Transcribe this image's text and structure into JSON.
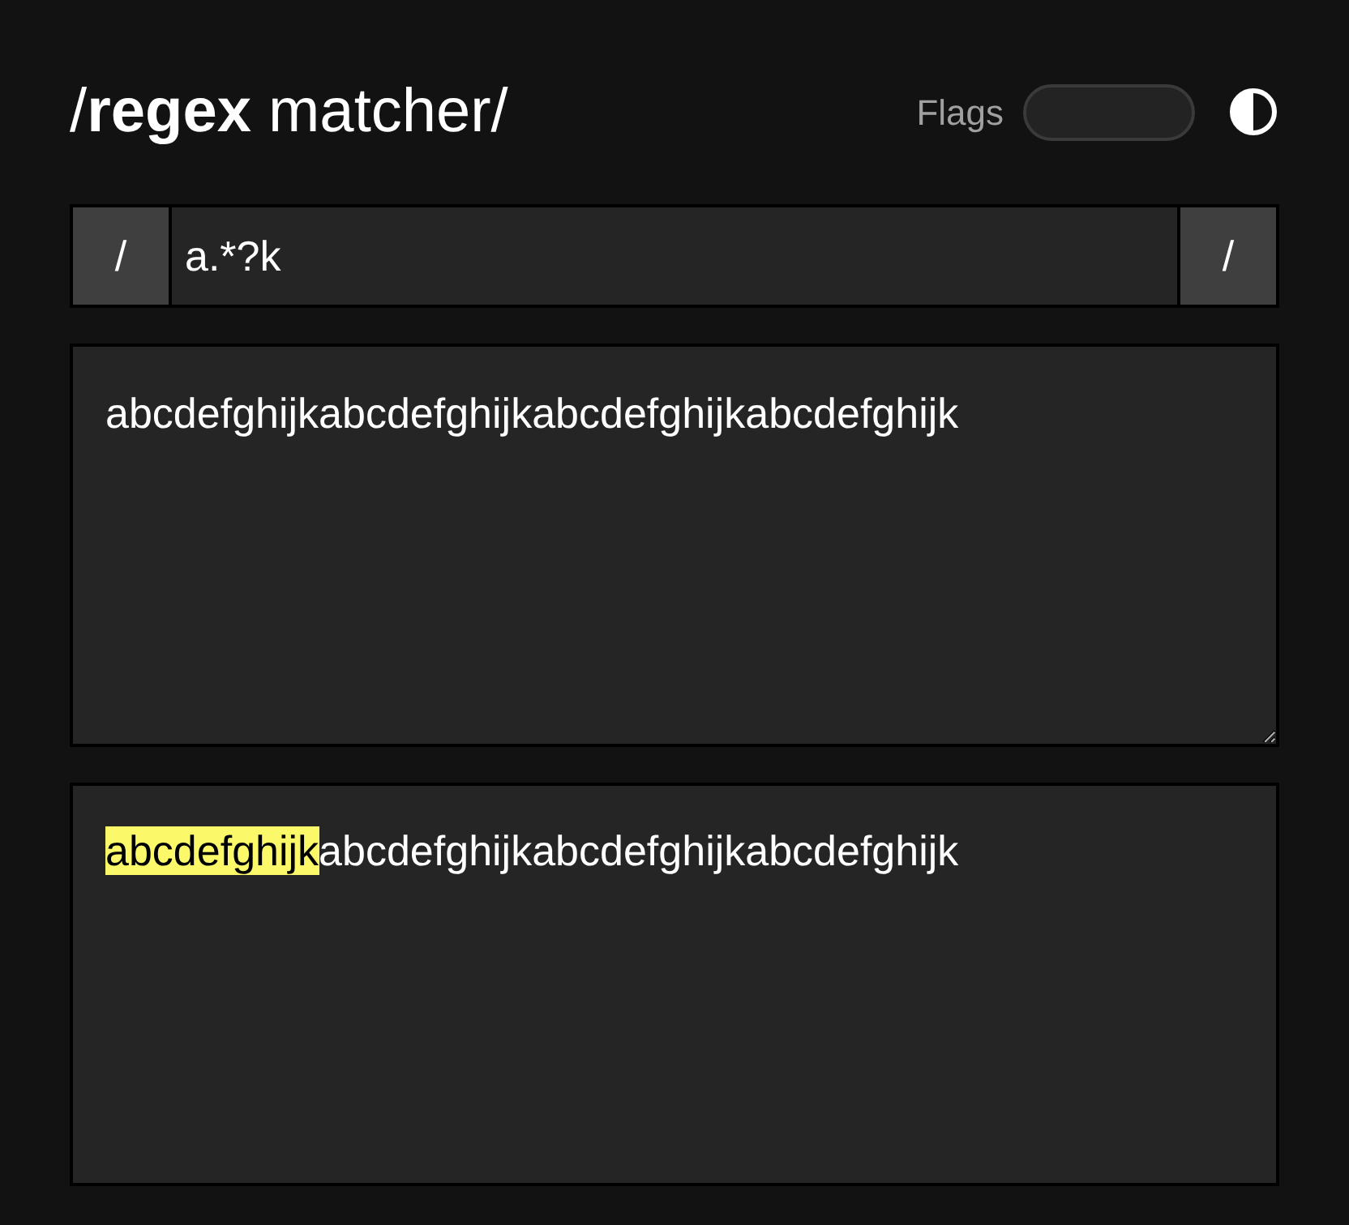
{
  "title": "/**regex** matcher/",
  "flags": {
    "label": "Flags"
  },
  "pattern": {
    "open": "/",
    "value": "a.*?k",
    "close": "/"
  },
  "test_text": {
    "value": "abcdefghijkabcdefghijkabcdefghijkabcdefghijk"
  },
  "result": {
    "segments": [
      {
        "text": "abcdefghijk",
        "matched": true
      },
      {
        "text": "abcdefghijkabcdefghijkabcdefghijk",
        "matched": false
      }
    ]
  }
}
